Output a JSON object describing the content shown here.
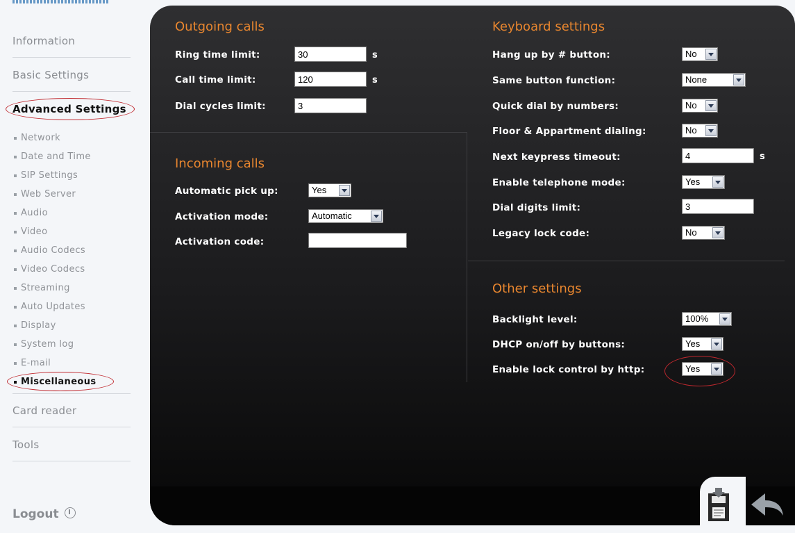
{
  "sidebar": {
    "main": {
      "information": "Information",
      "basic": "Basic Settings",
      "advanced": "Advanced Settings",
      "card_reader": "Card reader",
      "tools": "Tools"
    },
    "sub": [
      "Network",
      "Date and Time",
      "SIP Settings",
      "Web Server",
      "Audio",
      "Video",
      "Audio Codecs",
      "Video Codecs",
      "Streaming",
      "Auto Updates",
      "Display",
      "System log",
      "E-mail",
      "Miscellaneous"
    ],
    "active_sub": "Miscellaneous",
    "logout": "Logout"
  },
  "outgoing": {
    "title": "Outgoing calls",
    "ring_label": "Ring time limit:",
    "ring_value": "30",
    "ring_unit": "s",
    "call_label": "Call time limit:",
    "call_value": "120",
    "call_unit": "s",
    "dial_label": "Dial cycles limit:",
    "dial_value": "3"
  },
  "incoming": {
    "title": "Incoming calls",
    "pickup_label": "Automatic pick up:",
    "pickup_value": "Yes",
    "activation_label": "Activation mode:",
    "activation_value": "Automatic",
    "code_label": "Activation code:",
    "code_value": ""
  },
  "keyboard": {
    "title": "Keyboard settings",
    "hangup_label": "Hang up by # button:",
    "hangup_value": "No",
    "same_label": "Same button function:",
    "same_value": "None",
    "quick_label": "Quick dial by numbers:",
    "quick_value": "No",
    "floor_label": "Floor & Appartment dialing:",
    "floor_value": "No",
    "timeout_label": "Next keypress timeout:",
    "timeout_value": "4",
    "timeout_unit": "s",
    "telmode_label": "Enable telephone mode:",
    "telmode_value": "Yes",
    "digits_label": "Dial digits limit:",
    "digits_value": "3",
    "legacy_label": "Legacy lock code:",
    "legacy_value": "No"
  },
  "other": {
    "title": "Other settings",
    "backlight_label": "Backlight level:",
    "backlight_value": "100%",
    "dhcp_label": "DHCP on/off by buttons:",
    "dhcp_value": "Yes",
    "lockhttp_label": "Enable lock control by http:",
    "lockhttp_value": "Yes"
  },
  "colors": {
    "accent": "#e8862f",
    "highlight_circle": "#c0282e",
    "panel": "#1b1b1d"
  },
  "icons": {
    "save": "save-floppy-icon",
    "back": "back-arrow-icon",
    "logout": "power-icon"
  }
}
